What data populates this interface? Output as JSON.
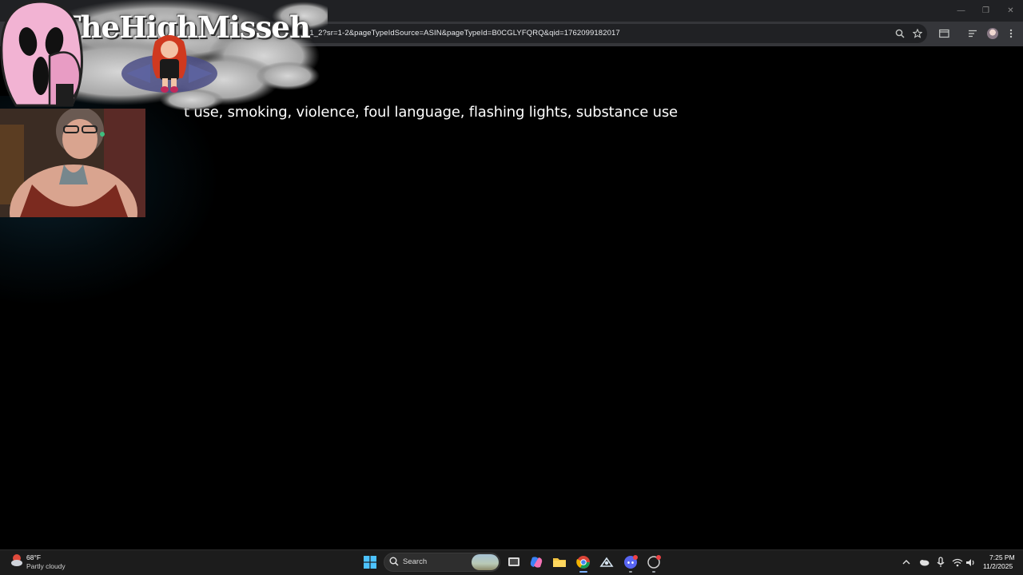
{
  "browser": {
    "url_visible": "_1_2?sr=1-2&pageTypeIdSource=ASIN&pageTypeId=B0CGLYFQRQ&qid=1762099182017",
    "window_controls": {
      "minimize": "—",
      "restore": "❐",
      "close": "✕"
    },
    "toolbar_icons": [
      "zoom-icon",
      "bookmark-star-icon",
      "tab-search-icon",
      "reading-list-icon",
      "profile-avatar",
      "menu-icon"
    ]
  },
  "page": {
    "content_warnings_text": "t use, smoking, violence, foul language, flashing lights, substance use"
  },
  "overlay": {
    "channel_name": "TheHighMisseh"
  },
  "taskbar": {
    "weather": {
      "temperature": "68°F",
      "condition": "Partly cloudy"
    },
    "search_placeholder": "Search",
    "apps": [
      "start-icon",
      "search",
      "task-view-icon",
      "copilot-icon",
      "file-explorer-icon",
      "chrome-icon",
      "steam-icon",
      "discord-icon",
      "app-icon"
    ],
    "clock": {
      "time": "7:25 PM",
      "date": "11/2/2025"
    }
  },
  "colors": {
    "tabstrip": "#202124",
    "toolbar": "#35363a",
    "omnibox": "#202124",
    "taskbar": "#1c1c1c",
    "accent": "#7db3ff"
  }
}
